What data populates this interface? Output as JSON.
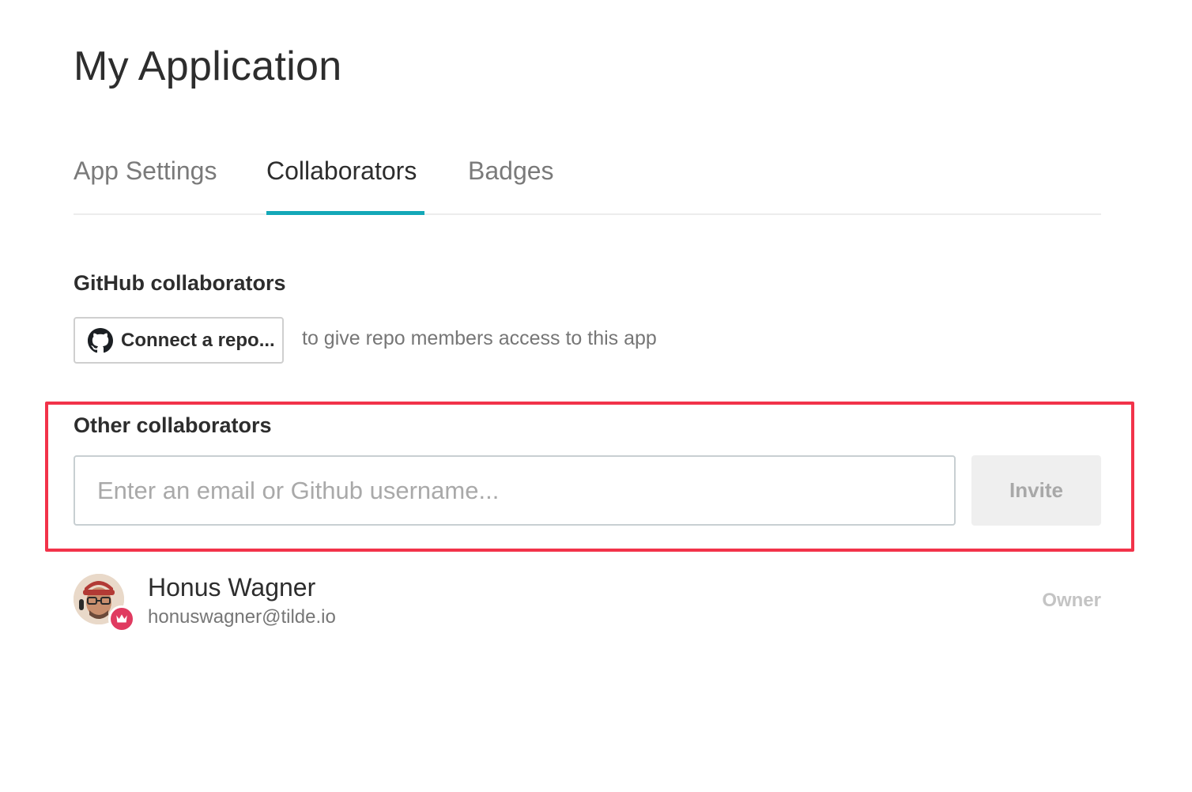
{
  "app": {
    "title": "My Application"
  },
  "tabs": [
    {
      "label": "App Settings",
      "active": false
    },
    {
      "label": "Collaborators",
      "active": true
    },
    {
      "label": "Badges",
      "active": false
    }
  ],
  "accent_color": "#14a8b8",
  "github_section": {
    "heading": "GitHub collaborators",
    "connect_button_label": "Connect a repo...",
    "connect_button_icon": "github-icon",
    "hint": "to give repo members access to this app"
  },
  "other_section": {
    "heading": "Other collaborators",
    "input_placeholder": "Enter an email or Github username...",
    "input_value": "",
    "invite_button_label": "Invite",
    "highlight_color": "#f2334a"
  },
  "collaborators": [
    {
      "name": "Honus Wagner",
      "email": "honuswagner@tilde.io",
      "role": "Owner",
      "badge_icon": "crown-icon",
      "badge_color": "#e03a60"
    }
  ]
}
